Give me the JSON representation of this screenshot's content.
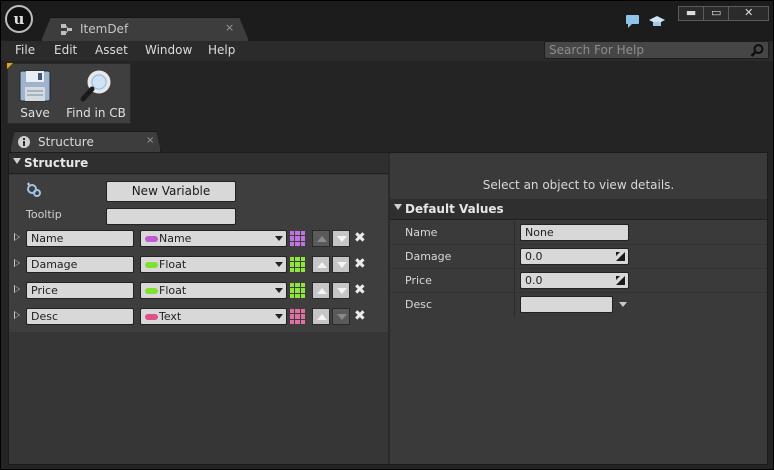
{
  "window": {
    "doc_tab_label": "ItemDef",
    "doc_tab_close": "×",
    "logo_letter": "u",
    "min_glyph": "▬",
    "restore_glyph": "▭",
    "close_glyph": "✕"
  },
  "menu": {
    "items": [
      "File",
      "Edit",
      "Asset",
      "Window",
      "Help"
    ],
    "search_placeholder": "Search For Help"
  },
  "toolbar": {
    "save_label": "Save",
    "find_label": "Find in CB"
  },
  "panel_tab": {
    "label": "Structure",
    "close": "×"
  },
  "structure": {
    "title": "Structure",
    "new_variable_label": "New Variable",
    "tooltip_label": "Tooltip",
    "tooltip_value": "",
    "variables": [
      {
        "name": "Name",
        "type": "Name",
        "pill_color": "#c05bd4",
        "grid_color": "#c074e0",
        "up_enabled": false,
        "down_enabled": true
      },
      {
        "name": "Damage",
        "type": "Float",
        "pill_color": "#7ee02f",
        "grid_color": "#8fe63a",
        "up_enabled": true,
        "down_enabled": true
      },
      {
        "name": "Price",
        "type": "Float",
        "pill_color": "#7ee02f",
        "grid_color": "#8fe63a",
        "up_enabled": true,
        "down_enabled": true
      },
      {
        "name": "Desc",
        "type": "Text",
        "pill_color": "#e0508a",
        "grid_color": "#e070a0",
        "up_enabled": true,
        "down_enabled": false
      }
    ],
    "remove_glyph": "✖"
  },
  "details": {
    "empty_note": "Select an object to view details.",
    "default_values_title": "Default Values",
    "rows": [
      {
        "label": "Name",
        "value": "None",
        "kind": "text"
      },
      {
        "label": "Damage",
        "value": "0.0",
        "kind": "number"
      },
      {
        "label": "Price",
        "value": "0.0",
        "kind": "number"
      },
      {
        "label": "Desc",
        "value": "",
        "kind": "combo"
      }
    ]
  },
  "colors": {
    "accent": "#e6a116",
    "button_bg": "#d8d8d8",
    "panel_bg": "#3a3a3a"
  },
  "icons": [
    "ue-logo-icon",
    "struct-asset-icon",
    "chat-icon",
    "graduation-cap-icon",
    "search-icon",
    "save-disk-icon",
    "magnifier-icon",
    "info-icon",
    "add-variable-icon",
    "expand-arrow-icon",
    "dropdown-arrow-icon",
    "array-grid-icon",
    "move-up-icon",
    "move-down-icon",
    "remove-icon",
    "drag-value-icon"
  ]
}
